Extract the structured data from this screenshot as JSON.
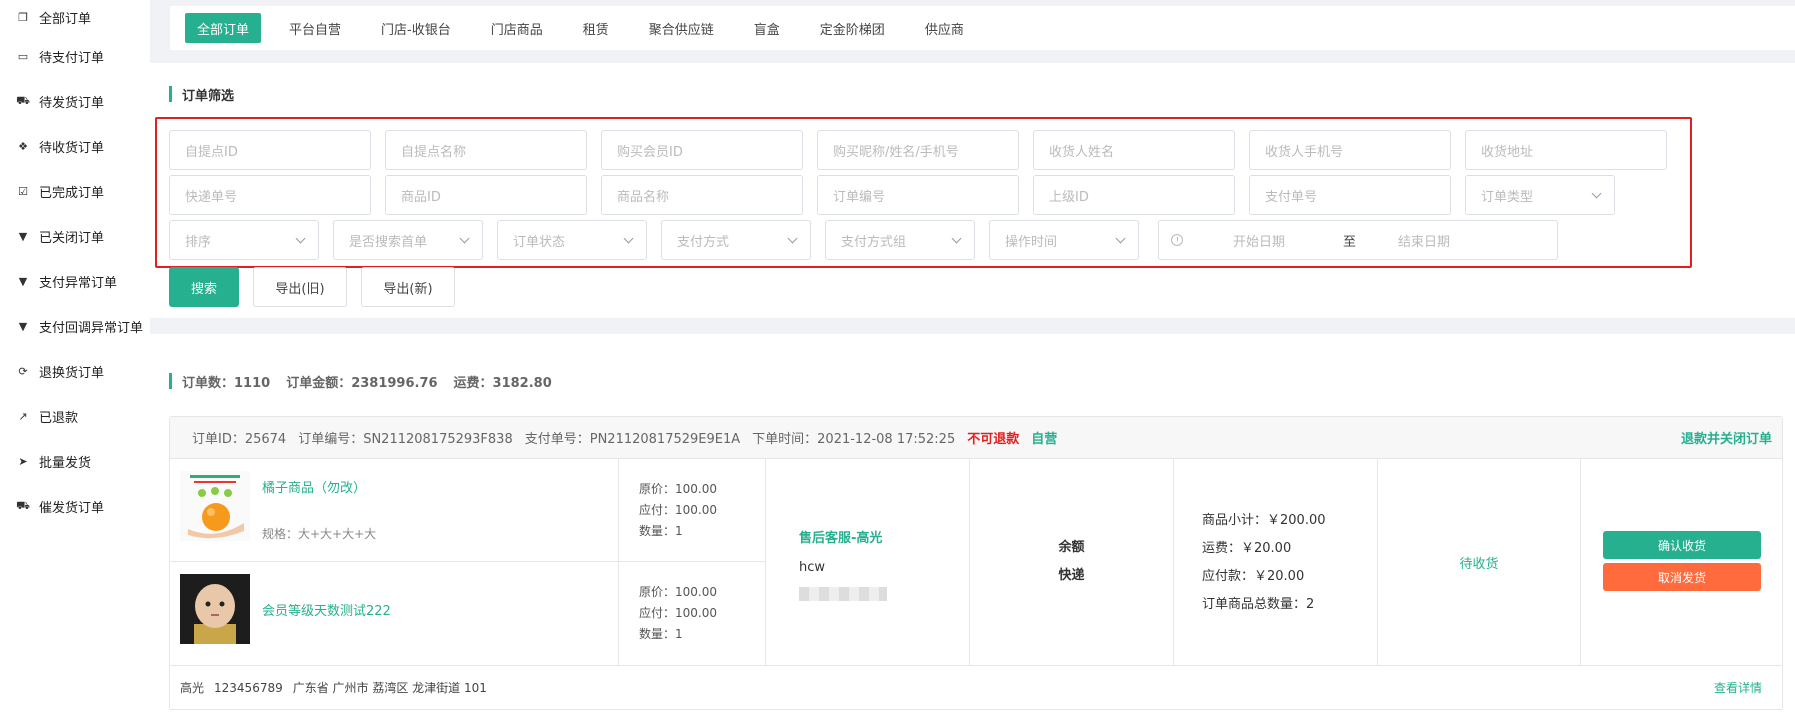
{
  "sidebar": {
    "items": [
      {
        "label": "全部订单",
        "icon": "copy-icon"
      },
      {
        "label": "待支付订单",
        "icon": "card-icon"
      },
      {
        "label": "待发货订单",
        "icon": "truck-icon"
      },
      {
        "label": "待收货订单",
        "icon": "dropbox-icon"
      },
      {
        "label": "已完成订单",
        "icon": "check-square-icon"
      },
      {
        "label": "已关闭订单",
        "icon": "cup-icon"
      },
      {
        "label": "支付异常订单",
        "icon": "cup-icon"
      },
      {
        "label": "支付回调异常订单",
        "icon": "cup-icon"
      },
      {
        "label": "退换货订单",
        "icon": "refresh-icon"
      },
      {
        "label": "已退款",
        "icon": "share-icon"
      },
      {
        "label": "批量发货",
        "icon": "send-icon"
      },
      {
        "label": "催发货订单",
        "icon": "truck-icon"
      }
    ]
  },
  "tabs": [
    "全部订单",
    "平台自营",
    "门店-收银台",
    "门店商品",
    "租赁",
    "聚合供应链",
    "盲盒",
    "定金阶梯团",
    "供应商"
  ],
  "filter": {
    "title": "订单筛选",
    "row1": [
      "自提点ID",
      "自提点名称",
      "购买会员ID",
      "购买昵称/姓名/手机号",
      "收货人姓名",
      "收货人手机号",
      "收货地址"
    ],
    "row2": [
      "快递单号",
      "商品ID",
      "商品名称",
      "订单编号",
      "上级ID",
      "支付单号"
    ],
    "row2_select": "订单类型",
    "row3_selects": [
      "排序",
      "是否搜索首单",
      "订单状态",
      "支付方式",
      "支付方式组",
      "操作时间"
    ],
    "date": {
      "start": "开始日期",
      "sep": "至",
      "end": "结束日期"
    },
    "buttons": {
      "search": "搜索",
      "export_old": "导出(旧)",
      "export_new": "导出(新)"
    }
  },
  "stats": {
    "count": "订单数：1110",
    "amount": "订单金额：2381996.76",
    "freight": "运费：3182.80"
  },
  "order": {
    "id": "订单ID：25674",
    "sn": "订单编号：SN211208175293F838",
    "pay_sn": "支付单号：PN21120817529E9E1A",
    "time": "下单时间：2021-12-08 17:52:25",
    "refund_flag": "不可退款",
    "self_flag": "自营",
    "close_link": "退款并关闭订单",
    "products": [
      {
        "name": "橘子商品（勿改）",
        "spec": "规格：大+大+大+大",
        "orig": "原价：100.00",
        "pay": "应付：100.00",
        "qty": "数量：1"
      },
      {
        "name": "会员等级天数测试222",
        "spec": "",
        "orig": "原价：100.00",
        "pay": "应付：100.00",
        "qty": "数量：1"
      }
    ],
    "service_title": "售后客服-高光",
    "service_user": "hcw",
    "pay_method": "余额",
    "ship_method": "快递",
    "subtotal": "商品小计：￥200.00",
    "freight": "运费：￥20.00",
    "payable": "应付款：￥20.00",
    "total_qty": "订单商品总数量：2",
    "status": "待收货",
    "confirm_btn": "确认收货",
    "cancel_btn": "取消发货",
    "receiver_name": "高光",
    "receiver_phone": "123456789",
    "receiver_addr": "广东省 广州市 荔湾区 龙津街道 101",
    "detail_link": "查看详情"
  }
}
